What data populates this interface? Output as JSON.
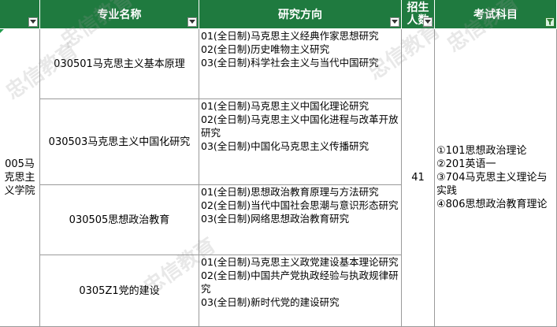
{
  "header": {
    "major_name": "专业名称",
    "research_direction": "研究方向",
    "enrollment_line1": "招生",
    "enrollment_line2": "人数",
    "exam_subjects": "考试科目"
  },
  "college": "005马克思主义学院",
  "enrollment": "41",
  "majors": [
    {
      "name": "030501马克思主义基本原理",
      "directions": [
        "01(全日制)马克思主义经典作家思想研究",
        "02(全日制)历史唯物主义研究",
        "03(全日制)科学社会主义与当代中国研究"
      ]
    },
    {
      "name": "030503马克思主义中国化研究",
      "directions": [
        "01(全日制)马克思主义中国化理论研究",
        "02(全日制)马克思主义中国化进程与改革开放研究",
        "03(全日制)中国化马克思主义传播研究"
      ]
    },
    {
      "name": "030505思想政治教育",
      "directions": [
        "01(全日制)思想政治教育原理与方法研究",
        "02(全日制)当代中国社会思潮与意识形态研究",
        "03(全日制)网络思想政治教育研究"
      ]
    },
    {
      "name": "0305Z1党的建设",
      "directions": [
        "01(全日制)马克思主义政党建设基本理论研究",
        "02(全日制)中国共产党执政经验与执政规律研究",
        "03(全日制)新时代党的建设研究"
      ]
    }
  ],
  "subjects": [
    "①101思想政治理论",
    "②201英语一",
    "③704马克思主义理论与实践",
    "④806思想政治教育理论"
  ],
  "watermark_text": "忠信教育",
  "colors": {
    "header_bg": "#1f7a3f",
    "header_text": "#ffffff",
    "grid": "#9a9a9a"
  }
}
